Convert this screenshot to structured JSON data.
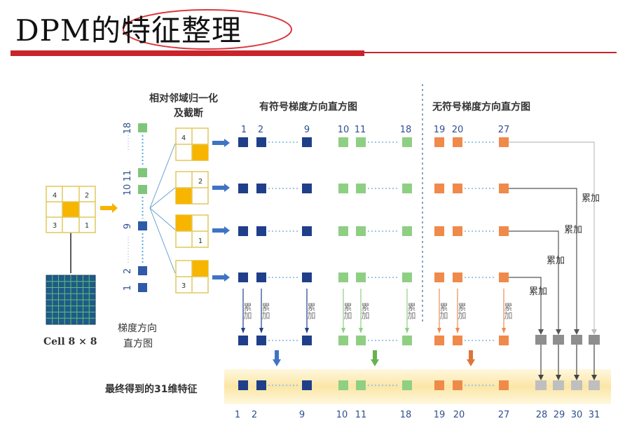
{
  "title": "DPM的特征整理",
  "labels": {
    "norm_line1": "相对邻域归一化",
    "norm_line2": "及截断",
    "signed_header": "有符号梯度方向直方图",
    "unsigned_header": "无符号梯度方向直方图",
    "hist_line1": "梯度方向",
    "hist_line2": "直方图",
    "cell_label": "Cell 8 × 8",
    "final_label": "最终得到的31维特征",
    "accumulate": "累加"
  },
  "cell_numbers": [
    "4",
    "2",
    "3",
    "1"
  ],
  "variant_numbers": [
    "4",
    "2",
    "1",
    "3"
  ],
  "hist_bin_labels": [
    "18",
    "11",
    "10",
    "9",
    "2",
    "1"
  ],
  "top_bin_labels": [
    "1",
    "2",
    "9",
    "10",
    "11",
    "18",
    "19",
    "20",
    "27"
  ],
  "bottom_bin_labels": [
    "1",
    "2",
    "9",
    "10",
    "11",
    "18",
    "19",
    "20",
    "27",
    "28",
    "29",
    "30",
    "31"
  ],
  "colors": {
    "title_underline": "#c8242a",
    "ellipse": "#d9383c",
    "signed_blue": "#1f3f8a",
    "signed_green": "#8fcf84",
    "unsigned_orange": "#f08a4b",
    "gray": "#8f8f8f",
    "band": "#fbe9b4",
    "cell_border": "#e0c85c",
    "cell_fill": "#f7b500"
  }
}
